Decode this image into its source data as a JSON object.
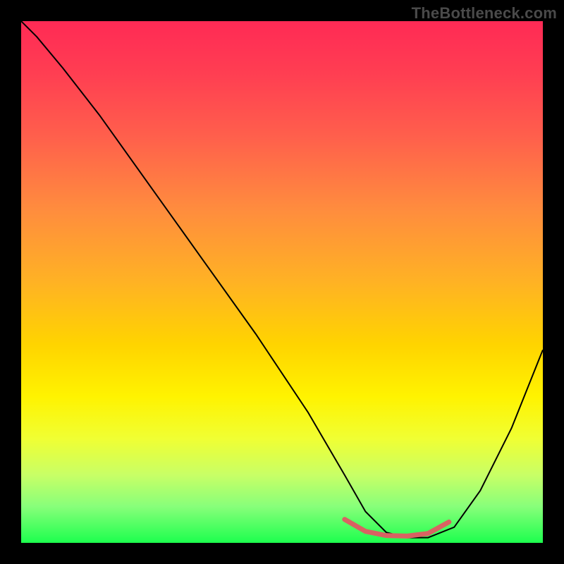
{
  "watermark": "TheBottleneck.com",
  "chart_data": {
    "type": "line",
    "title": "",
    "xlabel": "",
    "ylabel": "",
    "xlim": [
      0,
      100
    ],
    "ylim": [
      0,
      100
    ],
    "grid": false,
    "legend": false,
    "background_gradient": {
      "stops": [
        {
          "pos": 0.0,
          "color": "#ff2a55"
        },
        {
          "pos": 0.1,
          "color": "#ff3e52"
        },
        {
          "pos": 0.22,
          "color": "#ff5f4c"
        },
        {
          "pos": 0.36,
          "color": "#ff8c3e"
        },
        {
          "pos": 0.5,
          "color": "#ffb224"
        },
        {
          "pos": 0.62,
          "color": "#ffd400"
        },
        {
          "pos": 0.72,
          "color": "#fff300"
        },
        {
          "pos": 0.8,
          "color": "#f0ff33"
        },
        {
          "pos": 0.87,
          "color": "#c8ff66"
        },
        {
          "pos": 0.93,
          "color": "#88ff7a"
        },
        {
          "pos": 1.0,
          "color": "#1dff4e"
        }
      ]
    },
    "series": [
      {
        "name": "curve",
        "color": "#000000",
        "stroke_width": 2,
        "x": [
          0,
          3,
          8,
          15,
          25,
          35,
          45,
          55,
          62,
          66,
          70,
          74,
          78,
          83,
          88,
          94,
          100
        ],
        "y": [
          100,
          97,
          91,
          82,
          68,
          54,
          40,
          25,
          13,
          6,
          2,
          1,
          1,
          3,
          10,
          22,
          37
        ]
      },
      {
        "name": "highlight-segment",
        "color": "#d96262",
        "stroke_width": 7,
        "x": [
          62,
          66,
          70,
          74,
          78,
          82
        ],
        "y": [
          4.5,
          2.2,
          1.4,
          1.3,
          1.8,
          4.0
        ]
      }
    ]
  }
}
